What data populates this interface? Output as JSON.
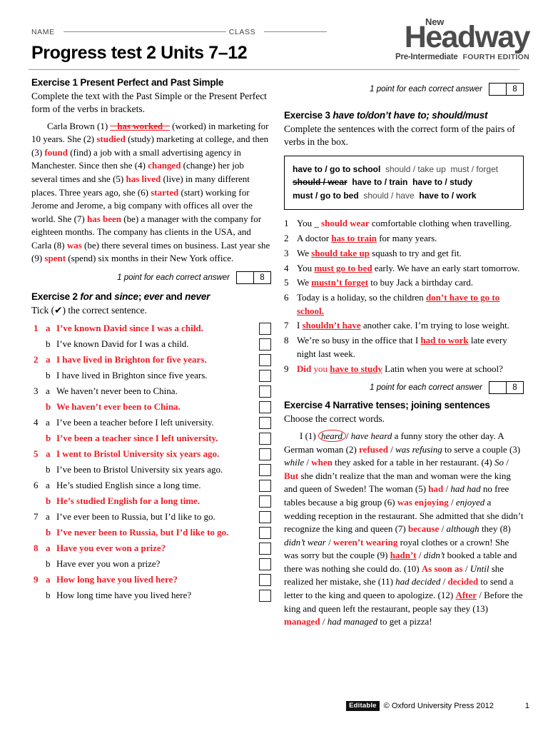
{
  "header": {
    "name_label": "NAME",
    "class_label": "CLASS",
    "title": "Progress test 2  Units 7–12",
    "logo": {
      "new": "New",
      "brand": "Headway",
      "level": "Pre-Intermediate",
      "edition": "FOURTH EDITION"
    }
  },
  "score": {
    "text": "1 point for each correct answer",
    "value": "8"
  },
  "exercise1": {
    "heading": "Exercise 1 Present Perfect and Past Simple",
    "instruction": "Complete the text with the Past Simple or the Present Perfect form of the verbs in brackets.",
    "text_parts": [
      {
        "t": "Carla Brown (1) ",
        "s": "plain"
      },
      {
        "t": "_ has worked _",
        "s": "red-strike-ans"
      },
      {
        "t": " (worked) in marketing for 10 years. She (2) ",
        "s": "plain"
      },
      {
        "t": "studied",
        "s": "red"
      },
      {
        "t": " (study) marketing at college, and then (3) ",
        "s": "plain"
      },
      {
        "t": "found",
        "s": "red"
      },
      {
        "t": " (find) a job with a small advertising agency in Manchester. Since then she (4) ",
        "s": "plain"
      },
      {
        "t": "changed",
        "s": "red"
      },
      {
        "t": " (change) her job several times and she (5) ",
        "s": "plain"
      },
      {
        "t": "has lived",
        "s": "red"
      },
      {
        "t": " (live) in many different places. Three years ago, she (6) ",
        "s": "plain"
      },
      {
        "t": "started",
        "s": "red"
      },
      {
        "t": " (start) working for Jerome and Jerome, a big company with offices all over the world. She (7) ",
        "s": "plain"
      },
      {
        "t": "has been",
        "s": "red"
      },
      {
        "t": " (be) a manager with the company for eighteen months. The company has clients in the USA, and Carla (8) ",
        "s": "plain"
      },
      {
        "t": "was",
        "s": "red"
      },
      {
        "t": " (be) there several times on business. Last year she (9) ",
        "s": "plain"
      },
      {
        "t": "spent",
        "s": "red"
      },
      {
        "t": " (spend) six months in their New York office.",
        "s": "plain"
      }
    ]
  },
  "exercise2": {
    "heading_plain": "Exercise 2 ",
    "heading_italic_parts": [
      "for",
      " and ",
      "since",
      "; ",
      "ever",
      " and ",
      "never"
    ],
    "instruction": "Tick (✔) the correct sentence.",
    "items": [
      {
        "num": "1",
        "options": [
          {
            "letter": "a",
            "text": "I’ve known David since I was a child.",
            "correct": true
          },
          {
            "letter": "b",
            "text": "I’ve known David for I was a child.",
            "correct": false
          }
        ]
      },
      {
        "num": "2",
        "options": [
          {
            "letter": "a",
            "text": "I have lived in Brighton for five years.",
            "correct": true
          },
          {
            "letter": "b",
            "text": "I have lived in Brighton since five years.",
            "correct": false
          }
        ]
      },
      {
        "num": "3",
        "options": [
          {
            "letter": "a",
            "text": "We haven’t never been to China.",
            "correct": false
          },
          {
            "letter": "b",
            "text": "We haven’t ever been to China.",
            "correct": true
          }
        ]
      },
      {
        "num": "4",
        "options": [
          {
            "letter": "a",
            "text": "I’ve been a teacher before I left university.",
            "correct": false
          },
          {
            "letter": "b",
            "text": "I’ve been a teacher since I left university.",
            "correct": true
          }
        ]
      },
      {
        "num": "5",
        "options": [
          {
            "letter": "a",
            "text": "I went to Bristol University six years ago.",
            "correct": true
          },
          {
            "letter": "b",
            "text": "I’ve been to Bristol University six years ago.",
            "correct": false
          }
        ]
      },
      {
        "num": "6",
        "options": [
          {
            "letter": "a",
            "text": "He’s studied English since a long time.",
            "correct": false
          },
          {
            "letter": "b",
            "text": "He’s studied English for a long time.",
            "correct": true
          }
        ]
      },
      {
        "num": "7",
        "options": [
          {
            "letter": "a",
            "text": "I’ve ever been to Russia, but I’d like to go.",
            "correct": false
          },
          {
            "letter": "b",
            "text": "I’ve never been to Russia, but I’d like to go.",
            "correct": true
          }
        ]
      },
      {
        "num": "8",
        "options": [
          {
            "letter": "a",
            "text": "Have you ever won a prize?",
            "correct": true
          },
          {
            "letter": "b",
            "text": "Have ever you won a prize?",
            "correct": false
          }
        ]
      },
      {
        "num": "9",
        "options": [
          {
            "letter": "a",
            "text": "How long have you lived here?",
            "correct": true
          },
          {
            "letter": "b",
            "text": "How long time have you lived here?",
            "correct": false
          }
        ]
      }
    ]
  },
  "exercise3": {
    "heading_plain": "Exercise 3 ",
    "heading_italic": "have to/don’t have to; should/must",
    "instruction": "Complete the sentences with the correct form of the pairs of verbs in the box.",
    "wordbox_rows": [
      [
        {
          "t": "have to / go to school",
          "s": "bold"
        },
        {
          "t": "should / take up",
          "s": "light"
        },
        {
          "t": "must / forget",
          "s": "light"
        }
      ],
      [
        {
          "t": "should / wear",
          "s": "strike"
        },
        {
          "t": "have to / train",
          "s": "bold"
        },
        {
          "t": "have to / study",
          "s": "bold"
        }
      ],
      [
        {
          "t": "must / go to bed",
          "s": "bold"
        },
        {
          "t": "should / have",
          "s": "light"
        },
        {
          "t": "have to / work",
          "s": "bold"
        }
      ]
    ],
    "items": [
      {
        "num": "1",
        "parts": [
          {
            "t": "You _ ",
            "s": "plain"
          },
          {
            "t": "should wear",
            "s": "red"
          },
          {
            "t": "  comfortable clothing when travelling.",
            "s": "plain"
          }
        ]
      },
      {
        "num": "2",
        "parts": [
          {
            "t": "A doctor ",
            "s": "plain"
          },
          {
            "t": "has to train",
            "s": "red-u"
          },
          {
            "t": " for many years.",
            "s": "plain"
          }
        ]
      },
      {
        "num": "3",
        "parts": [
          {
            "t": "We ",
            "s": "plain"
          },
          {
            "t": "should take up",
            "s": "red-u"
          },
          {
            "t": " squash to try and get fit.",
            "s": "plain"
          }
        ]
      },
      {
        "num": "4",
        "parts": [
          {
            "t": "You ",
            "s": "plain"
          },
          {
            "t": "must go to bed",
            "s": "red-u"
          },
          {
            "t": " early. We have an early start tomorrow.",
            "s": "plain"
          }
        ]
      },
      {
        "num": "5",
        "parts": [
          {
            "t": "We ",
            "s": "plain"
          },
          {
            "t": "mustn’t forget",
            "s": "red-u"
          },
          {
            "t": " to buy Jack a birthday card.",
            "s": "plain"
          }
        ]
      },
      {
        "num": "6",
        "parts": [
          {
            "t": "Today is a holiday, so the children ",
            "s": "plain"
          },
          {
            "t": "don’t have to go to school.",
            "s": "red-u"
          }
        ]
      },
      {
        "num": "7",
        "parts": [
          {
            "t": "I ",
            "s": "plain"
          },
          {
            "t": "shouldn’t have",
            "s": "red-u"
          },
          {
            "t": " another cake. I’m trying to lose weight.",
            "s": "plain"
          }
        ]
      },
      {
        "num": "8",
        "parts": [
          {
            "t": "We’re so busy in the office that I ",
            "s": "plain"
          },
          {
            "t": "had to work",
            "s": "red-u"
          },
          {
            "t": " late every night last week.",
            "s": "plain"
          }
        ]
      },
      {
        "num": "9",
        "parts": [
          {
            "t": "Did",
            "s": "red"
          },
          {
            "t": " you ",
            "s": "red-plain"
          },
          {
            "t": "have to study",
            "s": "red-u"
          },
          {
            "t": " Latin when you were at school?",
            "s": "plain"
          }
        ]
      }
    ]
  },
  "exercise4": {
    "heading": "Exercise 4 Narrative tenses; joining sentences",
    "instruction": "Choose the correct words.",
    "text_parts": [
      {
        "t": "I (1) ",
        "s": "plain"
      },
      {
        "t": "heard",
        "s": "circled"
      },
      {
        "t": "/ ",
        "s": "plain"
      },
      {
        "t": "have heard",
        "s": "it"
      },
      {
        "t": " a funny story the other day. A German woman (2) ",
        "s": "plain"
      },
      {
        "t": "refused",
        "s": "red"
      },
      {
        "t": " / ",
        "s": "plain"
      },
      {
        "t": "was refusing",
        "s": "it"
      },
      {
        "t": " to serve a couple (3) ",
        "s": "plain"
      },
      {
        "t": "while",
        "s": "it"
      },
      {
        "t": " / ",
        "s": "plain"
      },
      {
        "t": "when",
        "s": "red"
      },
      {
        "t": " they asked for a table in her restaurant. (4) ",
        "s": "plain"
      },
      {
        "t": "So",
        "s": "it"
      },
      {
        "t": " / ",
        "s": "plain"
      },
      {
        "t": "But",
        "s": "red"
      },
      {
        "t": " she didn’t realize that the man and woman were the king and queen of Sweden! The woman (5) ",
        "s": "plain"
      },
      {
        "t": "had",
        "s": "red"
      },
      {
        "t": " / ",
        "s": "plain"
      },
      {
        "t": "had had",
        "s": "it"
      },
      {
        "t": " no free tables because a big group (6) ",
        "s": "plain"
      },
      {
        "t": "was enjoying",
        "s": "red"
      },
      {
        "t": " / ",
        "s": "plain"
      },
      {
        "t": "enjoyed",
        "s": "it"
      },
      {
        "t": " a wedding reception in the restaurant. She admitted that she didn’t recognize the king and queen (7) ",
        "s": "plain"
      },
      {
        "t": "because",
        "s": "red"
      },
      {
        "t": " / ",
        "s": "plain"
      },
      {
        "t": "although",
        "s": "it"
      },
      {
        "t": " they (8) ",
        "s": "plain"
      },
      {
        "t": "didn’t wear",
        "s": "it"
      },
      {
        "t": " / ",
        "s": "plain"
      },
      {
        "t": "weren’t wearing",
        "s": "red"
      },
      {
        "t": " royal clothes or a crown! She was sorry but the couple (9) ",
        "s": "plain"
      },
      {
        "t": "hadn’t",
        "s": "red-u"
      },
      {
        "t": " / ",
        "s": "plain"
      },
      {
        "t": "didn’t",
        "s": "it"
      },
      {
        "t": " booked a table and there was nothing she could do. (10) ",
        "s": "plain"
      },
      {
        "t": "As soon as",
        "s": "red"
      },
      {
        "t": " / ",
        "s": "plain"
      },
      {
        "t": "Until",
        "s": "it"
      },
      {
        "t": " she realized her mistake, she (11) ",
        "s": "plain"
      },
      {
        "t": "had decided",
        "s": "it"
      },
      {
        "t": " / ",
        "s": "plain"
      },
      {
        "t": "decided",
        "s": "red"
      },
      {
        "t": " to send a letter to the king and queen to apologize. (12) ",
        "s": "plain"
      },
      {
        "t": "After",
        "s": "red-u"
      },
      {
        "t": " / ",
        "s": "plain"
      },
      {
        "t": "Before",
        "s": "plain"
      },
      {
        "t": " the king and queen left the restaurant, people say they (13) ",
        "s": "plain"
      },
      {
        "t": "managed",
        "s": "red"
      },
      {
        "t": " / ",
        "s": "plain"
      },
      {
        "t": "had managed",
        "s": "it"
      },
      {
        "t": " to get a pizza!",
        "s": "plain"
      }
    ]
  },
  "footer": {
    "editable": "Editable",
    "copyright": "© Oxford University Press 2012",
    "page": "1"
  }
}
